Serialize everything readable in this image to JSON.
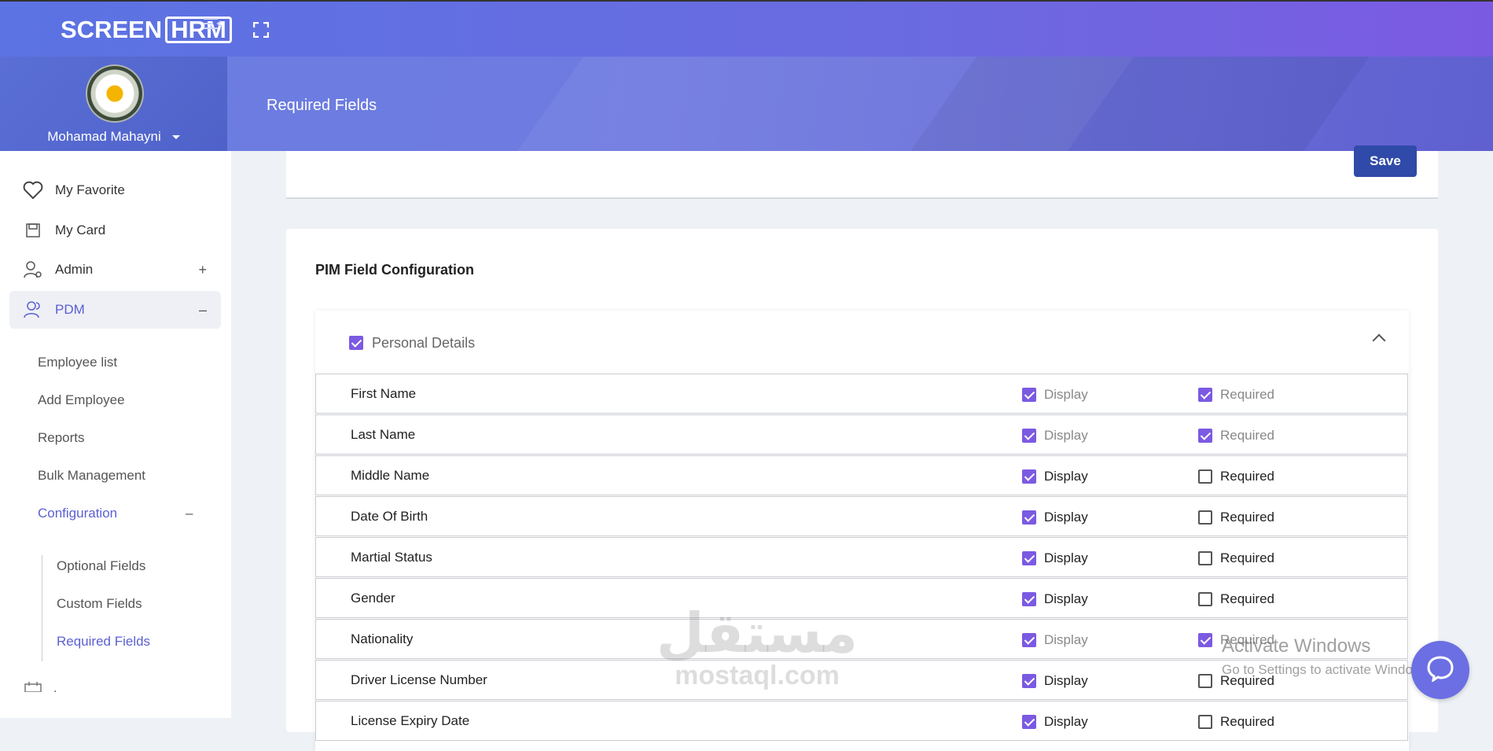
{
  "app": {
    "logo_left": "SCREEN",
    "logo_boxed": "HRM"
  },
  "header": {
    "user_name": "Mohamad Mahayni",
    "page_title": "Required Fields"
  },
  "sidebar": {
    "items": [
      {
        "label": "My Favorite",
        "icon": "heart-icon",
        "toggle": ""
      },
      {
        "label": "My Card",
        "icon": "save-icon",
        "toggle": ""
      },
      {
        "label": "Admin",
        "icon": "user-gear-icon",
        "toggle": "+"
      },
      {
        "label": "PDM",
        "icon": "users-icon",
        "toggle": "–"
      }
    ],
    "pdm_sub": [
      {
        "label": "Employee list"
      },
      {
        "label": "Add Employee"
      },
      {
        "label": "Reports"
      },
      {
        "label": "Bulk Management"
      },
      {
        "label": "Configuration",
        "toggle": "–"
      }
    ],
    "config_sub": [
      {
        "label": "Optional Fields"
      },
      {
        "label": "Custom Fields"
      },
      {
        "label": "Required Fields"
      }
    ],
    "partial_item_label": "."
  },
  "actions": {
    "save_label": "Save"
  },
  "config": {
    "section_title": "PIM Field Configuration",
    "group_label": "Personal Details",
    "group_checked": true,
    "display_label": "Display",
    "required_label": "Required",
    "rows": [
      {
        "name": "First Name",
        "display": true,
        "required": true,
        "display_muted": true,
        "required_muted": true
      },
      {
        "name": "Last Name",
        "display": true,
        "required": true,
        "display_muted": true,
        "required_muted": true
      },
      {
        "name": "Middle Name",
        "display": true,
        "required": false
      },
      {
        "name": "Date Of Birth",
        "display": true,
        "required": false
      },
      {
        "name": "Martial Status",
        "display": true,
        "required": false
      },
      {
        "name": "Gender",
        "display": true,
        "required": false
      },
      {
        "name": "Nationality",
        "display": true,
        "required": true,
        "display_muted": true,
        "required_muted": true
      },
      {
        "name": "Driver License Number",
        "display": true,
        "required": false
      },
      {
        "name": "License Expiry Date",
        "display": true,
        "required": false
      }
    ]
  },
  "overlay": {
    "watermark_ar": "مستقل",
    "watermark_en": "mostaql.com",
    "activate_title": "Activate Windows",
    "activate_sub": "Go to Settings to activate Windows."
  },
  "colors": {
    "accent": "#7b5ae2",
    "active_nav": "#5b5fd3",
    "save_button": "#2f4aa8"
  }
}
